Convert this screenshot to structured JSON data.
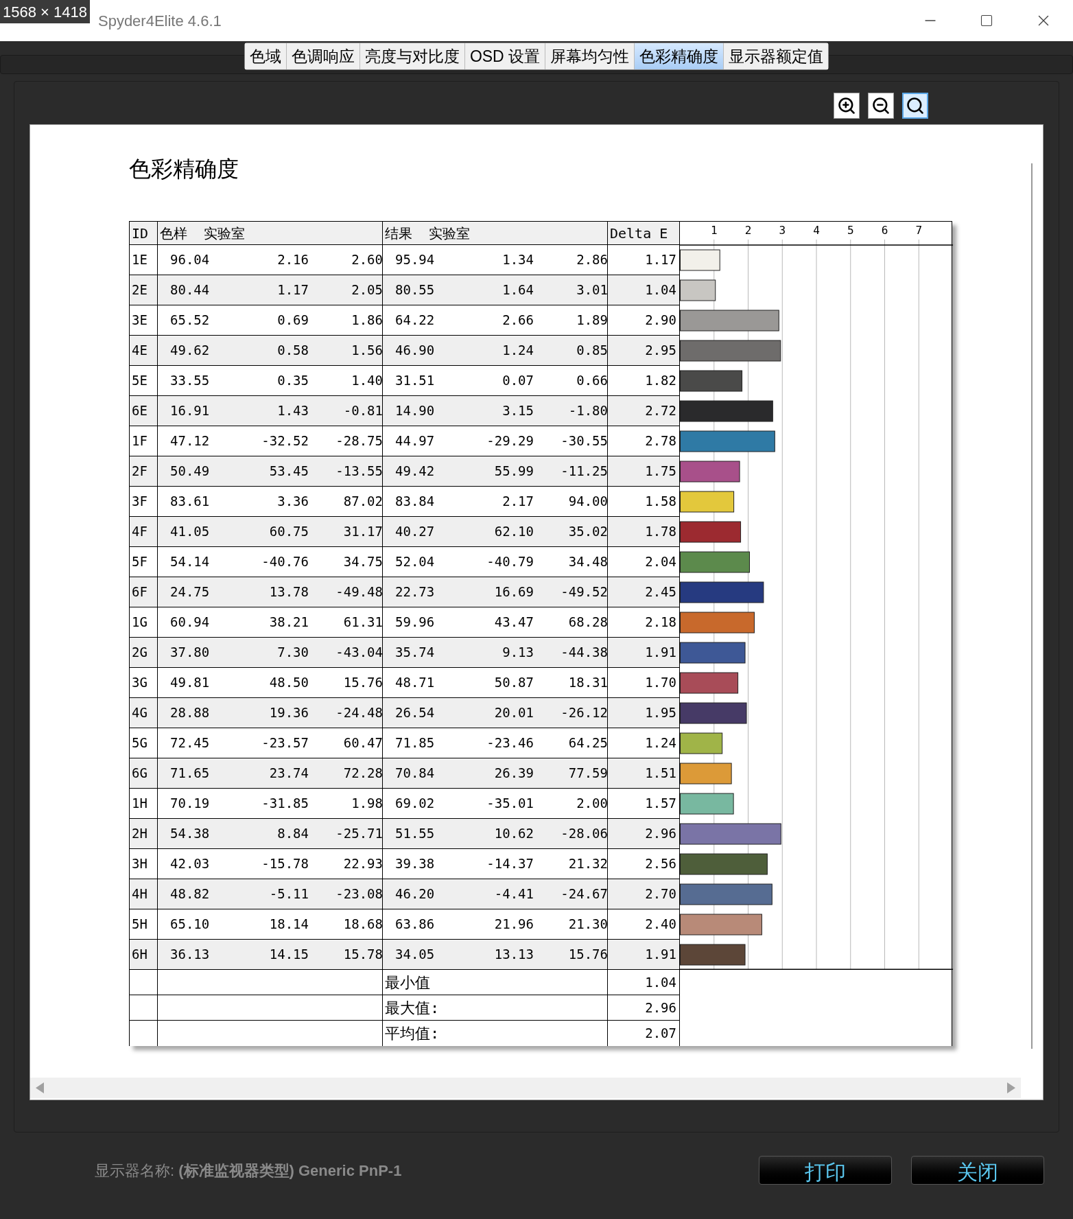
{
  "capture_badge": "1568 × 1418",
  "window": {
    "title": "Spyder4Elite 4.6.1"
  },
  "tabs": [
    {
      "label": "色域",
      "selected": false
    },
    {
      "label": "色调响应",
      "selected": false
    },
    {
      "label": "亮度与对比度",
      "selected": false
    },
    {
      "label": "OSD 设置",
      "selected": false
    },
    {
      "label": "屏幕均匀性",
      "selected": false
    },
    {
      "label": "色彩精确度",
      "selected": true
    },
    {
      "label": "显示器额定值",
      "selected": false
    }
  ],
  "zoom_tools": [
    {
      "kind": "zoom_in",
      "selected": false
    },
    {
      "kind": "zoom_out",
      "selected": false
    },
    {
      "kind": "fit",
      "selected": true
    }
  ],
  "report": {
    "title": "色彩精确度",
    "columns": [
      "ID",
      "色样  实验室",
      "结果  实验室",
      "Delta E"
    ],
    "rows": [
      {
        "id": "1E",
        "sample": [
          "96.04",
          "2.16",
          "2.60"
        ],
        "result": [
          "95.94",
          "1.34",
          "2.86"
        ],
        "delta_e": "1.17",
        "color": "#f2f0ea"
      },
      {
        "id": "2E",
        "sample": [
          "80.44",
          "1.17",
          "2.05"
        ],
        "result": [
          "80.55",
          "1.64",
          "3.01"
        ],
        "delta_e": "1.04",
        "color": "#c8c6c2"
      },
      {
        "id": "3E",
        "sample": [
          "65.52",
          "0.69",
          "1.86"
        ],
        "result": [
          "64.22",
          "2.66",
          "1.89"
        ],
        "delta_e": "2.90",
        "color": "#9a9896"
      },
      {
        "id": "4E",
        "sample": [
          "49.62",
          "0.58",
          "1.56"
        ],
        "result": [
          "46.90",
          "1.24",
          "0.85"
        ],
        "delta_e": "2.95",
        "color": "#6e6c6b"
      },
      {
        "id": "5E",
        "sample": [
          "33.55",
          "0.35",
          "1.40"
        ],
        "result": [
          "31.51",
          "0.07",
          "0.66"
        ],
        "delta_e": "1.82",
        "color": "#4a4a49"
      },
      {
        "id": "6E",
        "sample": [
          "16.91",
          "1.43",
          "-0.81"
        ],
        "result": [
          "14.90",
          "3.15",
          "-1.80"
        ],
        "delta_e": "2.72",
        "color": "#2a2a2c"
      },
      {
        "id": "1F",
        "sample": [
          "47.12",
          "-32.52",
          "-28.75"
        ],
        "result": [
          "44.97",
          "-29.29",
          "-30.55"
        ],
        "delta_e": "2.78",
        "color": "#2f7aa5"
      },
      {
        "id": "2F",
        "sample": [
          "50.49",
          "53.45",
          "-13.55"
        ],
        "result": [
          "49.42",
          "55.99",
          "-11.25"
        ],
        "delta_e": "1.75",
        "color": "#a8508a"
      },
      {
        "id": "3F",
        "sample": [
          "83.61",
          "3.36",
          "87.02"
        ],
        "result": [
          "83.84",
          "2.17",
          "94.00"
        ],
        "delta_e": "1.58",
        "color": "#e3c83c"
      },
      {
        "id": "4F",
        "sample": [
          "41.05",
          "60.75",
          "31.17"
        ],
        "result": [
          "40.27",
          "62.10",
          "35.02"
        ],
        "delta_e": "1.78",
        "color": "#9c2a30"
      },
      {
        "id": "5F",
        "sample": [
          "54.14",
          "-40.76",
          "34.75"
        ],
        "result": [
          "52.04",
          "-40.79",
          "34.48"
        ],
        "delta_e": "2.04",
        "color": "#5c8a4c"
      },
      {
        "id": "6F",
        "sample": [
          "24.75",
          "13.78",
          "-49.48"
        ],
        "result": [
          "22.73",
          "16.69",
          "-49.52"
        ],
        "delta_e": "2.45",
        "color": "#263a80"
      },
      {
        "id": "1G",
        "sample": [
          "60.94",
          "38.21",
          "61.31"
        ],
        "result": [
          "59.96",
          "43.47",
          "68.28"
        ],
        "delta_e": "2.18",
        "color": "#c8692c"
      },
      {
        "id": "2G",
        "sample": [
          "37.80",
          "7.30",
          "-43.04"
        ],
        "result": [
          "35.74",
          "9.13",
          "-44.38"
        ],
        "delta_e": "1.91",
        "color": "#3e5896"
      },
      {
        "id": "3G",
        "sample": [
          "49.81",
          "48.50",
          "15.76"
        ],
        "result": [
          "48.71",
          "50.87",
          "18.31"
        ],
        "delta_e": "1.70",
        "color": "#a84c58"
      },
      {
        "id": "4G",
        "sample": [
          "28.88",
          "19.36",
          "-24.48"
        ],
        "result": [
          "26.54",
          "20.01",
          "-26.12"
        ],
        "delta_e": "1.95",
        "color": "#463a66"
      },
      {
        "id": "5G",
        "sample": [
          "72.45",
          "-23.57",
          "60.47"
        ],
        "result": [
          "71.85",
          "-23.46",
          "64.25"
        ],
        "delta_e": "1.24",
        "color": "#a0b448"
      },
      {
        "id": "6G",
        "sample": [
          "71.65",
          "23.74",
          "72.28"
        ],
        "result": [
          "70.84",
          "26.39",
          "77.59"
        ],
        "delta_e": "1.51",
        "color": "#dc9a38"
      },
      {
        "id": "1H",
        "sample": [
          "70.19",
          "-31.85",
          "1.98"
        ],
        "result": [
          "69.02",
          "-35.01",
          "2.00"
        ],
        "delta_e": "1.57",
        "color": "#78b8a0"
      },
      {
        "id": "2H",
        "sample": [
          "54.38",
          "8.84",
          "-25.71"
        ],
        "result": [
          "51.55",
          "10.62",
          "-28.06"
        ],
        "delta_e": "2.96",
        "color": "#7a74a6"
      },
      {
        "id": "3H",
        "sample": [
          "42.03",
          "-15.78",
          "22.93"
        ],
        "result": [
          "39.38",
          "-14.37",
          "21.32"
        ],
        "delta_e": "2.56",
        "color": "#4e5e3a"
      },
      {
        "id": "4H",
        "sample": [
          "48.82",
          "-5.11",
          "-23.08"
        ],
        "result": [
          "46.20",
          "-4.41",
          "-24.67"
        ],
        "delta_e": "2.70",
        "color": "#566c92"
      },
      {
        "id": "5H",
        "sample": [
          "65.10",
          "18.14",
          "18.68"
        ],
        "result": [
          "63.86",
          "21.96",
          "21.30"
        ],
        "delta_e": "2.40",
        "color": "#b88a78"
      },
      {
        "id": "6H",
        "sample": [
          "36.13",
          "14.15",
          "15.78"
        ],
        "result": [
          "34.05",
          "13.13",
          "15.76"
        ],
        "delta_e": "1.91",
        "color": "#5c4638"
      }
    ],
    "summary": [
      {
        "label": "最小值",
        "value": "1.04"
      },
      {
        "label": "最大值:",
        "value": "2.96"
      },
      {
        "label": "平均值:",
        "value": "2.07"
      }
    ],
    "chart_data": {
      "type": "bar",
      "orientation": "horizontal",
      "grid": true,
      "values": [
        1.17,
        1.04,
        2.9,
        2.95,
        1.82,
        2.72,
        2.78,
        1.75,
        1.58,
        1.78,
        2.04,
        2.45,
        2.18,
        1.91,
        1.7,
        1.95,
        1.24,
        1.51,
        1.57,
        2.96,
        2.56,
        2.7,
        2.4,
        1.91
      ],
      "xlim": [
        0,
        8
      ],
      "xticks": [
        1,
        2,
        3,
        4,
        5,
        6,
        7
      ]
    }
  },
  "footer": {
    "display_name": "显示器名称: **(标准监视器类型) Generic PnP-1**"
  },
  "buttons": [
    "打印",
    "关闭"
  ]
}
